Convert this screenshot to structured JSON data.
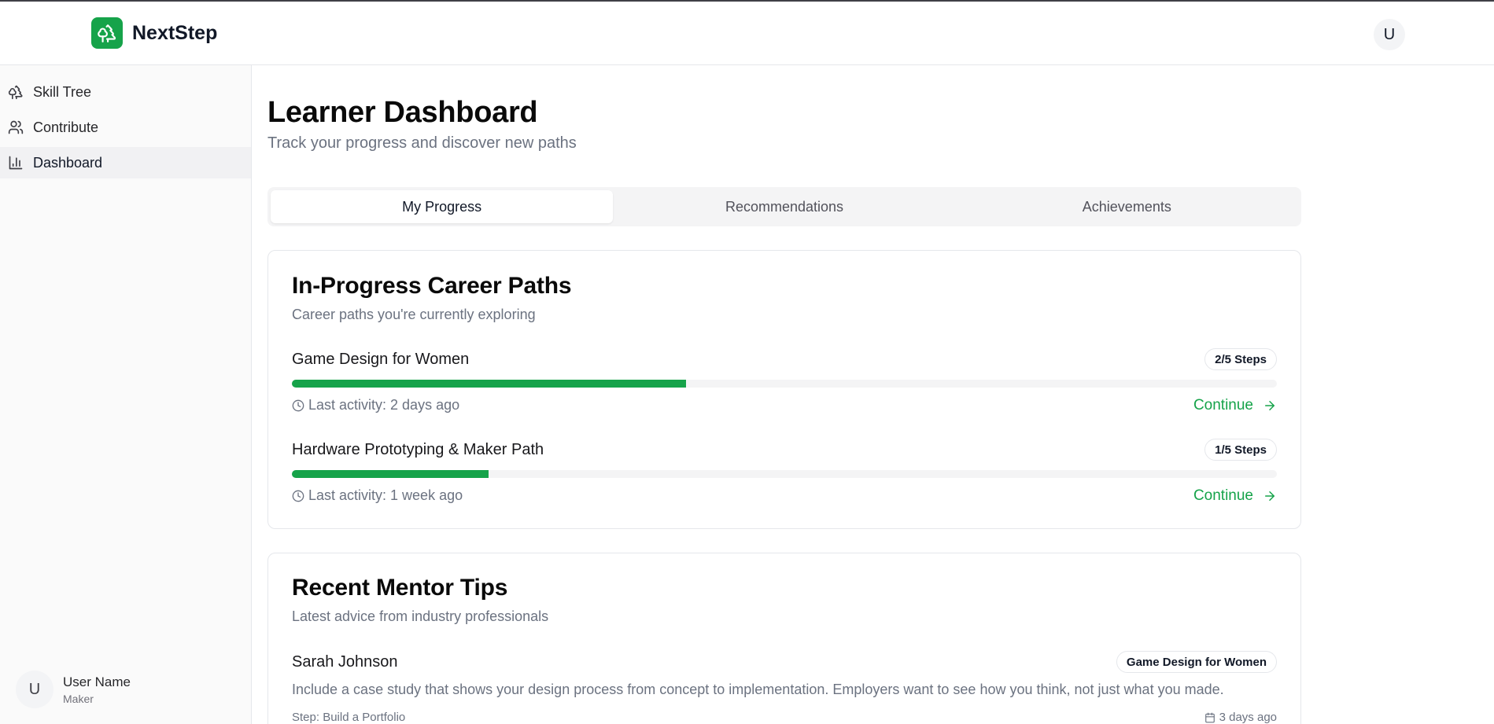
{
  "app": {
    "name": "NextStep",
    "logo_icon": "tree-icon",
    "accent_color": "#16a34a"
  },
  "header": {
    "avatar_initial": "U"
  },
  "sidebar": {
    "items": [
      {
        "label": "Skill Tree",
        "icon": "tree-icon",
        "active": false
      },
      {
        "label": "Contribute",
        "icon": "users-icon",
        "active": false
      },
      {
        "label": "Dashboard",
        "icon": "bar-chart-icon",
        "active": true
      }
    ],
    "user": {
      "initial": "U",
      "name": "User Name",
      "role": "Maker"
    }
  },
  "page": {
    "title": "Learner Dashboard",
    "subtitle": "Track your progress and discover new paths"
  },
  "tabs": [
    {
      "label": "My Progress",
      "active": true
    },
    {
      "label": "Recommendations",
      "active": false
    },
    {
      "label": "Achievements",
      "active": false
    }
  ],
  "in_progress": {
    "title": "In-Progress Career Paths",
    "subtitle": "Career paths you're currently exploring",
    "paths": [
      {
        "name": "Game Design for Women",
        "steps": "2/5 Steps",
        "progress": 0.4,
        "activity": "Last activity: 2 days ago",
        "action": "Continue"
      },
      {
        "name": "Hardware Prototyping & Maker Path",
        "steps": "1/5 Steps",
        "progress": 0.2,
        "activity": "Last activity: 1 week ago",
        "action": "Continue"
      }
    ]
  },
  "mentor_tips": {
    "title": "Recent Mentor Tips",
    "subtitle": "Latest advice from industry professionals",
    "tips": [
      {
        "author": "Sarah Johnson",
        "path": "Game Design for Women",
        "text": "Include a case study that shows your design process from concept to implementation. Employers want to see how you think, not just what you made.",
        "step": "Step: Build a Portfolio",
        "date": "3 days ago"
      }
    ]
  }
}
